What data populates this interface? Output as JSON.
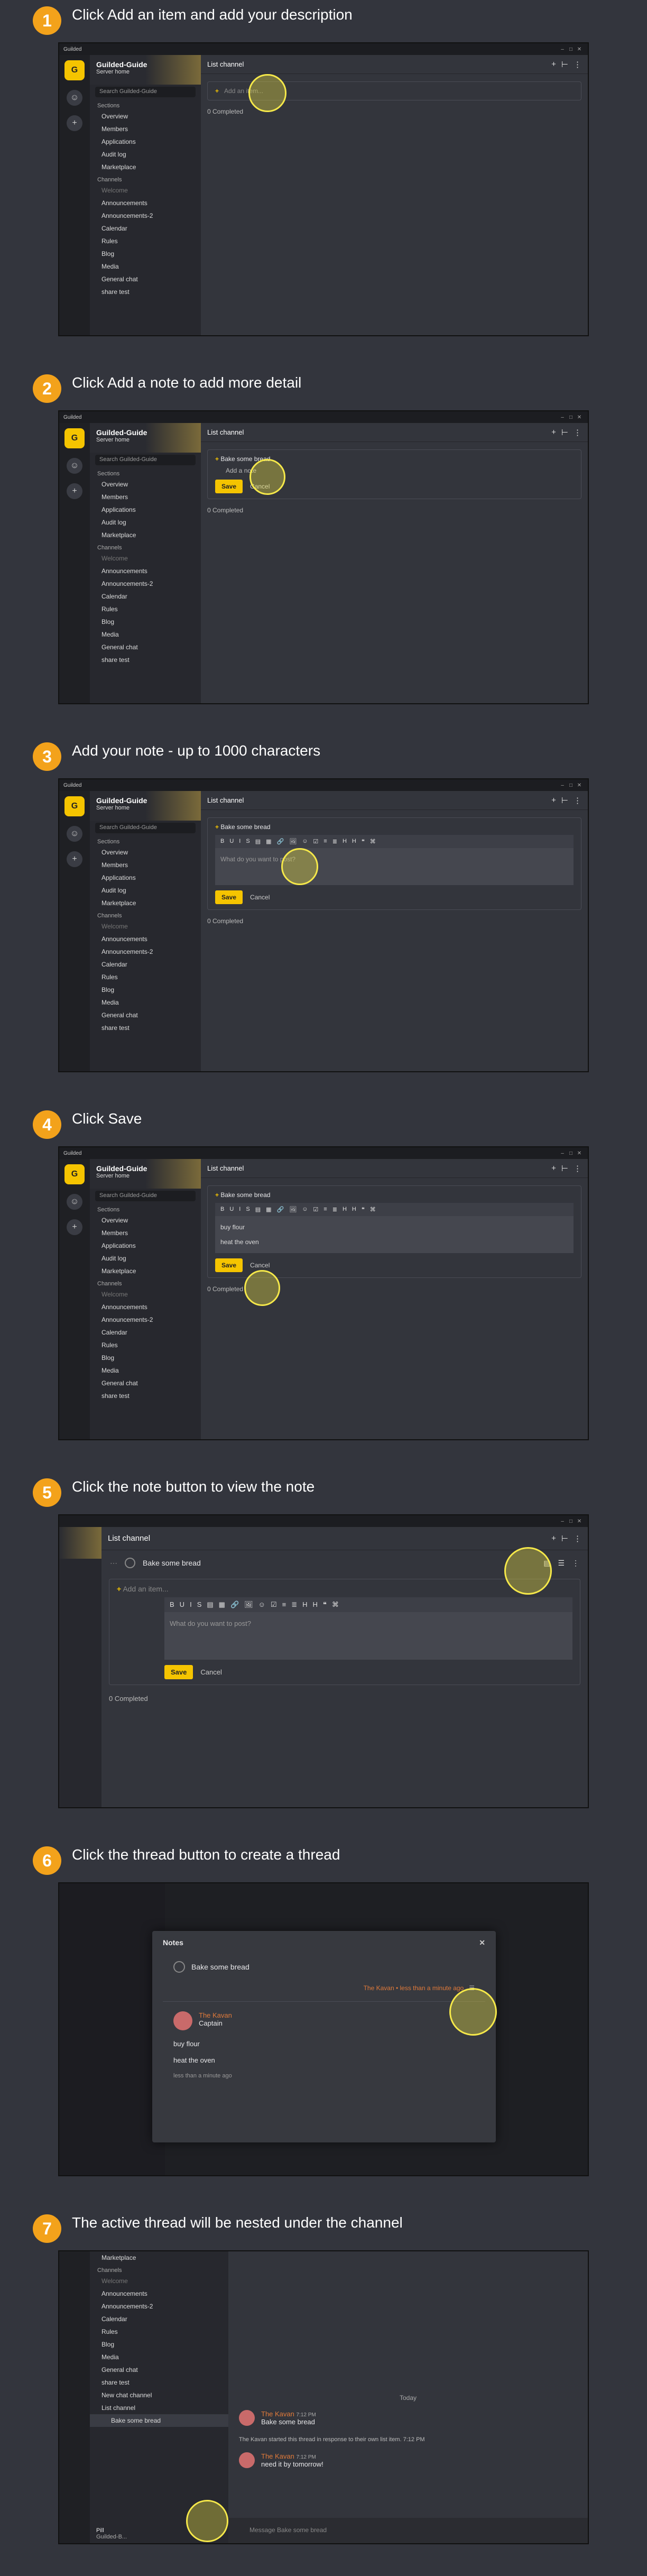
{
  "steps": [
    {
      "num": "1",
      "title": "Click Add an item and add your description"
    },
    {
      "num": "2",
      "title": "Click Add a note to add more detail"
    },
    {
      "num": "3",
      "title": "Add your note - up to 1000 characters"
    },
    {
      "num": "4",
      "title": "Click Save"
    },
    {
      "num": "5",
      "title": "Click the note button to view the note"
    },
    {
      "num": "6",
      "title": "Click the thread button to create a thread"
    },
    {
      "num": "7",
      "title": "The active thread will be nested under the channel"
    }
  ],
  "app": {
    "window_title": "Guilded",
    "server_name": "Guilded-Guide",
    "server_sub": "Server home",
    "search_placeholder": "Search Guilded-Guide",
    "sections_label": "Sections",
    "channels_label": "Channels",
    "section_items": [
      "Overview",
      "Members",
      "Applications",
      "Audit log",
      "Marketplace"
    ],
    "channel_items": [
      "Welcome",
      "Announcements",
      "Announcements-2",
      "Calendar",
      "Rules",
      "Blog",
      "Media",
      "General chat",
      "share test"
    ],
    "channel_title": "List channel",
    "add_item": "Add an item...",
    "add_note": "Add a note",
    "completed": "0 Completed",
    "item_text": "Bake some bread",
    "note_placeholder": "What do you want to post?",
    "save": "Save",
    "cancel": "Cancel",
    "note_line1": "buy flour",
    "note_line2": "heat the oven",
    "toolbar": [
      "B",
      "U",
      "I",
      "S",
      "▤",
      "▦",
      "🔗",
      "🖼",
      "☺",
      "☑",
      "≡",
      "≣",
      "H",
      "H",
      "❝",
      "⌘"
    ]
  },
  "modal": {
    "title": "Notes",
    "item": "Bake some bread",
    "author": "The Kavan",
    "author_line": "The Kavan • less than a minute ago",
    "author2": "The Kavan",
    "role": "Captain",
    "line1": "buy flour",
    "line2": "heat the oven",
    "time": "less than a minute ago"
  },
  "thread": {
    "sidebar_items": [
      "Marketplace",
      "Channels",
      "Welcome",
      "Announcements",
      "Announcements-2",
      "Calendar",
      "Rules",
      "Blog",
      "Media",
      "General chat",
      "share test",
      "New chat channel",
      "List channel",
      "Bake some bread"
    ],
    "today": "Today",
    "msg1_author": "The Kavan",
    "msg1_time": "7:12 PM",
    "msg1_text": "Bake some bread",
    "sys_text": "The Kavan started this thread in response to their own list item. 7:12 PM",
    "msg2_author": "The Kavan",
    "msg2_time": "7:12 PM",
    "msg2_text": "need it by tomorrow!",
    "composer": "Message Bake some bread",
    "user_name": "Pill",
    "user_sub": "Guilded-B..."
  }
}
